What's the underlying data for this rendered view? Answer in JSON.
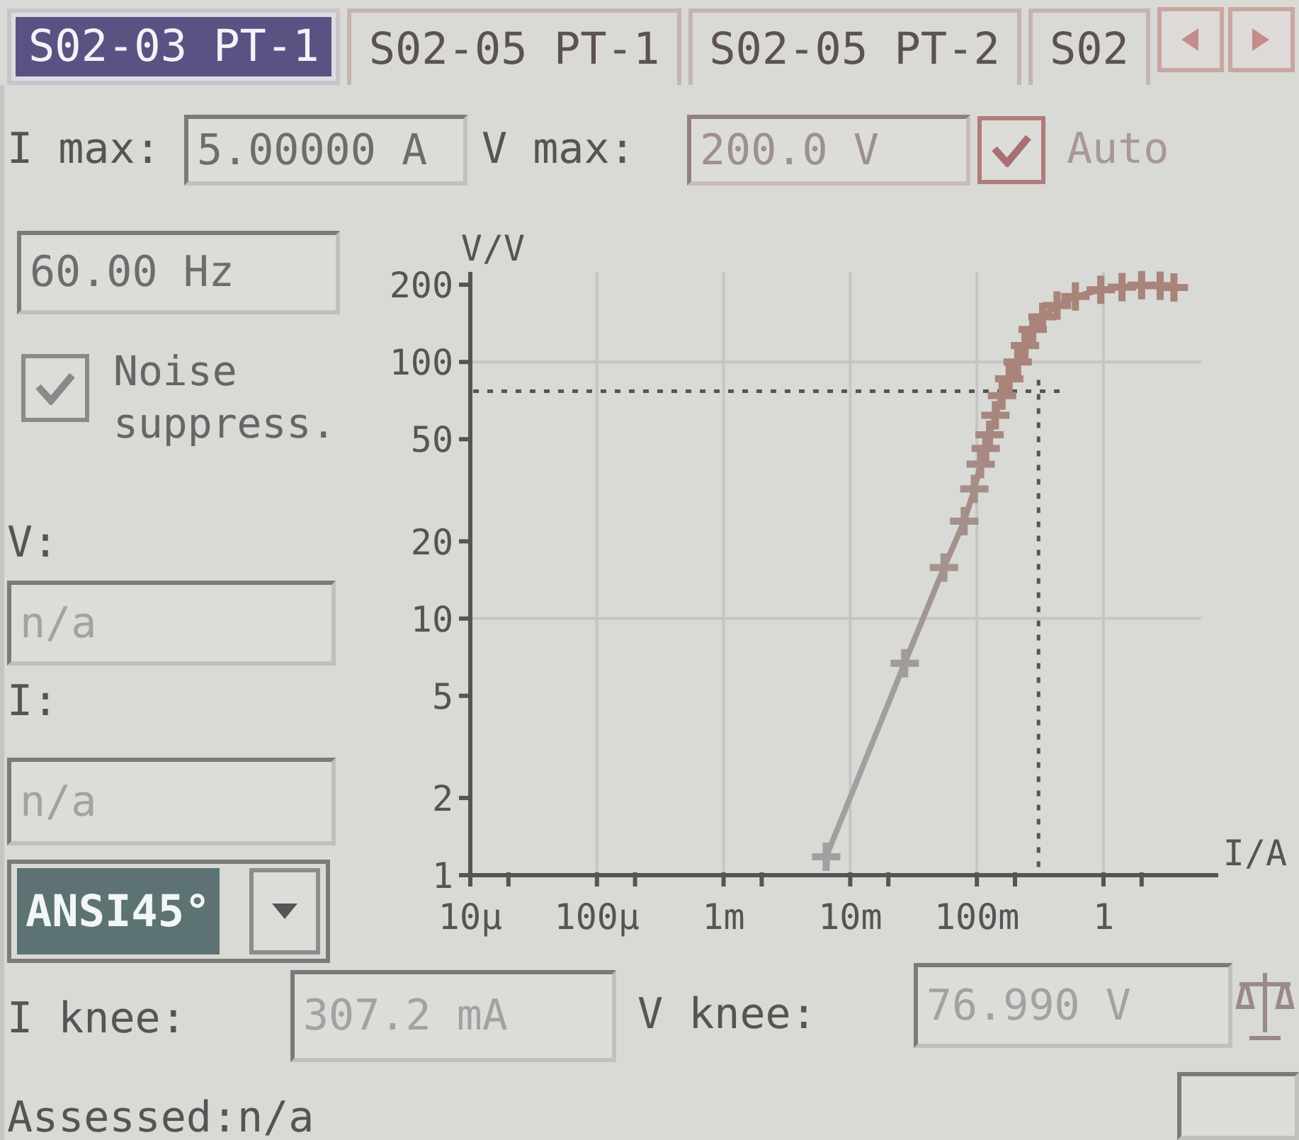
{
  "tabs": [
    {
      "label": "S02-03 PT-1",
      "selected": true
    },
    {
      "label": "S02-05 PT-1",
      "selected": false
    },
    {
      "label": "S02-05 PT-2",
      "selected": false
    },
    {
      "label": "S02",
      "selected": false
    }
  ],
  "limits": {
    "i_max": {
      "label": "I max:",
      "value": "5.00000 A",
      "disabled": false
    },
    "v_max": {
      "label": "V max:",
      "value": "200.0 V",
      "disabled": true
    },
    "auto": {
      "label": "Auto",
      "checked": true
    }
  },
  "frequency": {
    "value": "60.00 Hz",
    "disabled": false
  },
  "noise_suppress": {
    "label": "Noise suppress.",
    "checked": true
  },
  "readings": [
    {
      "label": "V:",
      "value": "n/a",
      "disabled": true
    },
    {
      "label": "I:",
      "value": "n/a",
      "disabled": true
    }
  ],
  "standard": {
    "value": "ANSI45°"
  },
  "chart": {
    "ylabel": "V/V",
    "xlabel": "I/A",
    "yticks": [
      "200",
      "100",
      "50",
      "20",
      "10",
      "5",
      "2",
      "1"
    ],
    "xticks": [
      "10µ",
      "100µ",
      "1m",
      "10m",
      "100m",
      "1"
    ]
  },
  "knee": [
    {
      "label": "I knee:",
      "value": "307.2 mA",
      "disabled": true
    },
    {
      "label": "V knee:",
      "value": "76.990 V",
      "disabled": true
    }
  ],
  "status": "Assessed:n/a"
}
